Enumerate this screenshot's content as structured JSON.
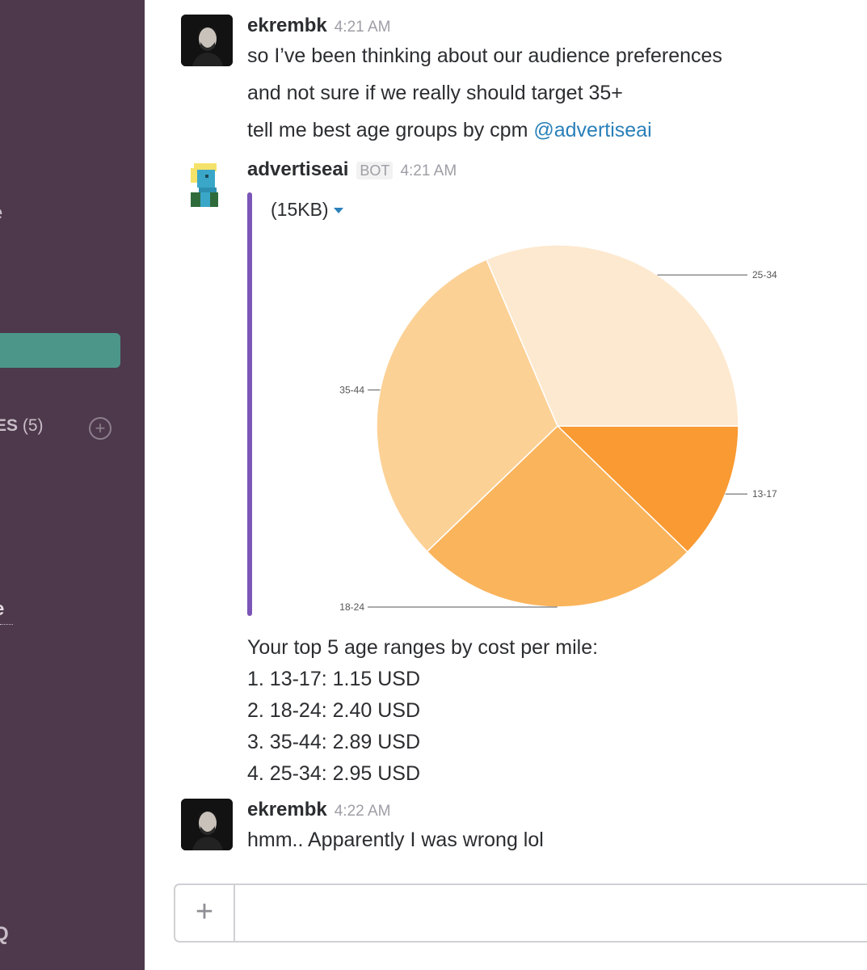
{
  "sidebar": {
    "item_a": "e",
    "item_b": "t",
    "section": {
      "label": "ES",
      "count": "(5)"
    },
    "item_c": "e",
    "bottom": "Q"
  },
  "messages": [
    {
      "author": "ekrembk",
      "time": "4:21 AM",
      "lines": [
        "so I’ve been thinking about our audience preferences",
        "and not sure if we really should target 35+",
        "tell me best age groups by cpm "
      ],
      "mention": "@advertiseai"
    },
    {
      "author": "advertiseai",
      "badge": "BOT",
      "time": "4:21 AM",
      "attachment": {
        "size_label": "(15KB)"
      },
      "result_lines": [
        "Your top 5 age ranges by cost per mile:",
        "1. 13-17: 1.15 USD",
        "2. 18-24: 2.40 USD",
        "3. 35-44: 2.89 USD",
        "4. 25-34: 2.95 USD"
      ]
    },
    {
      "author": "ekrembk",
      "time": "4:22 AM",
      "lines": [
        "hmm.. Apparently I was wrong lol"
      ]
    }
  ],
  "composer": {
    "plus": "+"
  },
  "chart_data": {
    "type": "pie",
    "categories": [
      "13-17",
      "18-24",
      "35-44",
      "25-34"
    ],
    "values": [
      1.15,
      2.4,
      2.89,
      2.95
    ],
    "colors": [
      "#f99a32",
      "#fab45c",
      "#fcd196",
      "#fde9cf"
    ],
    "start_angle_deg": 0,
    "title": ""
  }
}
